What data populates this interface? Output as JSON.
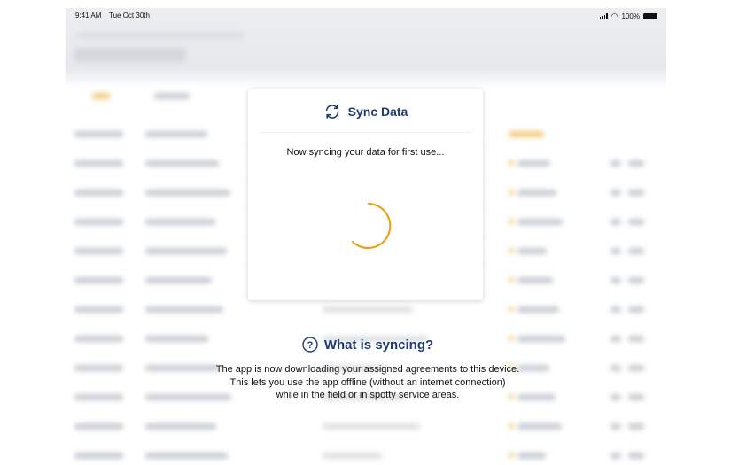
{
  "status_bar": {
    "time": "9:41 AM",
    "date": "Tue Oct 30th",
    "battery": "100%"
  },
  "modal": {
    "title": "Sync Data",
    "message": "Now syncing your data for first use...",
    "spinner_color": "#E8A317"
  },
  "info": {
    "title": "What is syncing?",
    "lines": [
      "The app is now downloading your assigned agreements to this device.",
      "This lets you use the app offline (without an internet connection)",
      "while in the field or in spotty service areas."
    ]
  },
  "colors": {
    "accent": "#1F3B72",
    "spinner": "#E8A317"
  }
}
